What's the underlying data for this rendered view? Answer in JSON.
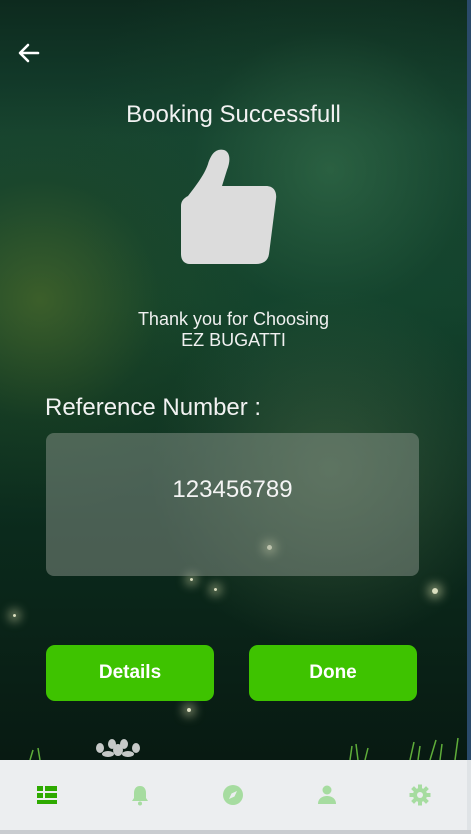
{
  "header": {
    "title": "Booking Successfull"
  },
  "thank_you": {
    "line1": "Thank you for Choosing",
    "line2": "EZ BUGATTI"
  },
  "reference": {
    "label": "Reference Number :",
    "value": "123456789"
  },
  "actions": {
    "details_label": "Details",
    "done_label": "Done"
  },
  "bottom_nav": {
    "items": [
      {
        "icon": "dashboard-icon",
        "active": true
      },
      {
        "icon": "bell-icon",
        "active": false
      },
      {
        "icon": "compass-icon",
        "active": false
      },
      {
        "icon": "person-icon",
        "active": false
      },
      {
        "icon": "gear-icon",
        "active": false
      }
    ]
  },
  "colors": {
    "accent": "#3ec300",
    "nav_active": "#2eaa00",
    "nav_inactive": "#a6dca0",
    "background_dark": "#0d2a1e"
  }
}
